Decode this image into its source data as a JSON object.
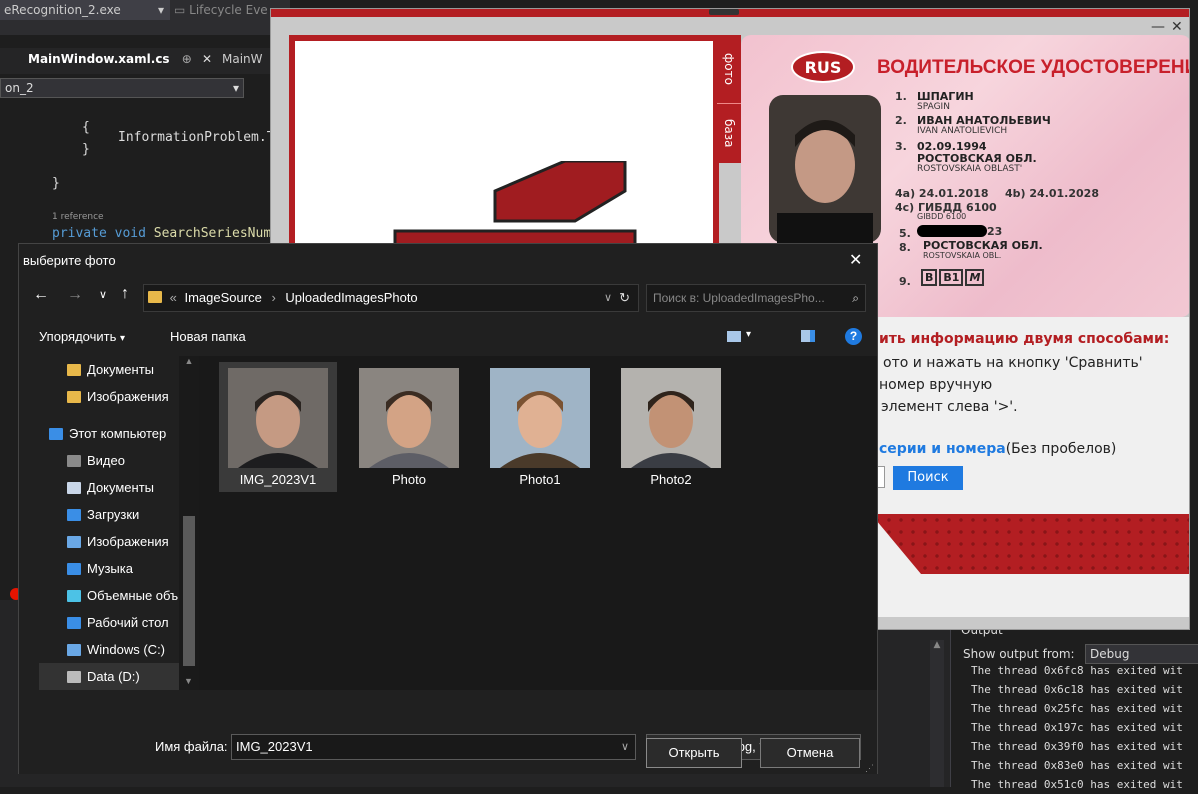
{
  "vs": {
    "process": "eRecognition_2.exe",
    "lifecycle": "Lifecycle Eve",
    "tab_active": "MainWindow.xaml.cs",
    "tab_pin": "⊕",
    "tab_other": "MainW",
    "project_box": "on_2",
    "code": {
      "line1": "InformationProblem.T",
      "refs": "1 reference",
      "sig_kw": "private void",
      "sig_name": "SearchSeriesNum"
    },
    "output_title": "Output",
    "output_from_label": "Show output from:",
    "output_from_value": "Debug",
    "output_lines": [
      "The thread 0x6fc8 has exited wit",
      "The thread 0x6c18 has exited wit",
      "The thread 0x25fc has exited wit",
      "The thread 0x197c has exited wit",
      "The thread 0x39f0 has exited wit",
      "The thread 0x83e0 has exited wit",
      "The thread 0x51c0 has exited wit"
    ]
  },
  "app": {
    "side_tab_photo": "фото",
    "side_tab_base": "база",
    "card": {
      "rus": "RUS",
      "title": "ВОДИТЕЛЬСКОЕ УДОСТОВЕРЕНИЕ",
      "lines": [
        {
          "n": "1.",
          "main": "ШПАГИН",
          "sub": "SPAGIN"
        },
        {
          "n": "2.",
          "main": "ИВАН АНАТОЛЬЕВИЧ",
          "sub": "IVAN ANATOLIEVICH"
        },
        {
          "n": "3.",
          "main": "02.09.1994",
          "sub": ""
        },
        {
          "n": "",
          "main": "РОСТОВСКАЯ ОБЛ.",
          "sub": "ROSTOVSKAIA OBLAST'"
        }
      ],
      "d4a": "4a) 24.01.2018",
      "d4b": "4b) 24.01.2028",
      "d4c": "4c) ГИБДД 6100",
      "d4c_sub": "GIBDD 6100",
      "d5": "23",
      "d8": "РОСТОВСКАЯ ОБЛ.",
      "d8_sub": "ROSTOVSKAIA OBL.",
      "d9_label": "9.",
      "categories": [
        "B",
        "B1",
        "M"
      ],
      "n5": "5.",
      "n8": "8."
    },
    "info_title": "ить информацию двумя способами:",
    "info_l1": "ото и нажать на кнопку  'Сравнить'",
    "info_l2": " номер вручную",
    "info_l3": "элемент слева '>'.",
    "series_link": "серии и номера",
    "series_note": "(Без пробелов)",
    "search_btn": "Поиск"
  },
  "dialog": {
    "title": "выберите фото",
    "path": [
      "ImageSource",
      "UploadedImagesPhoto"
    ],
    "path_sep": "›",
    "path_prefix": "«",
    "search_placeholder": "Поиск в: UploadedImagesPho...",
    "organize": "Упорядочить",
    "new_folder": "Новая папка",
    "nav": [
      {
        "label": "Документы",
        "icon": "folder-icon",
        "color": "#e8b84a"
      },
      {
        "label": "Изображения",
        "icon": "folder-icon",
        "color": "#e8b84a"
      },
      {
        "label": "Этот компьютер",
        "icon": "computer-icon",
        "color": "#3a8ee6"
      },
      {
        "label": "Видео",
        "icon": "video-icon",
        "color": "#8a8a8a"
      },
      {
        "label": "Документы",
        "icon": "document-icon",
        "color": "#c9d6e8"
      },
      {
        "label": "Загрузки",
        "icon": "download-icon",
        "color": "#3a8ee6"
      },
      {
        "label": "Изображения",
        "icon": "pictures-icon",
        "color": "#6aa8e6"
      },
      {
        "label": "Музыка",
        "icon": "music-icon",
        "color": "#3a8ee6"
      },
      {
        "label": "Объемные объ",
        "icon": "3d-objects-icon",
        "color": "#4cc2e6"
      },
      {
        "label": "Рабочий стол",
        "icon": "desktop-icon",
        "color": "#3a8ee6"
      },
      {
        "label": "Windows (C:)",
        "icon": "drive-c-icon",
        "color": "#6aa8e6"
      },
      {
        "label": "Data (D:)",
        "icon": "drive-d-icon",
        "color": "#bbbbbb"
      }
    ],
    "files": [
      {
        "name": "IMG_2023V1",
        "bg": "#6f6a66",
        "skin": "#c59a83",
        "hair": "#2a2420",
        "shirt": "#1d1d1f"
      },
      {
        "name": "Photo",
        "bg": "#8a8580",
        "skin": "#d3a385",
        "hair": "#3a2c22",
        "shirt": "#5d5e66"
      },
      {
        "name": "Photo1",
        "bg": "#9fb4c6",
        "skin": "#e0b193",
        "hair": "#7a5232",
        "shirt": "#4a3a2a"
      },
      {
        "name": "Photo2",
        "bg": "#b4b2ae",
        "skin": "#c29275",
        "hair": "#2f241c",
        "shirt": "#3a3d44"
      }
    ],
    "filename_label": "Имя файла:",
    "filename_value": "IMG_2023V1",
    "filter_value": "Image Files (*.jpg, *.jpeg, *.png,",
    "open_btn": "Открыть",
    "cancel_btn": "Отмена"
  }
}
